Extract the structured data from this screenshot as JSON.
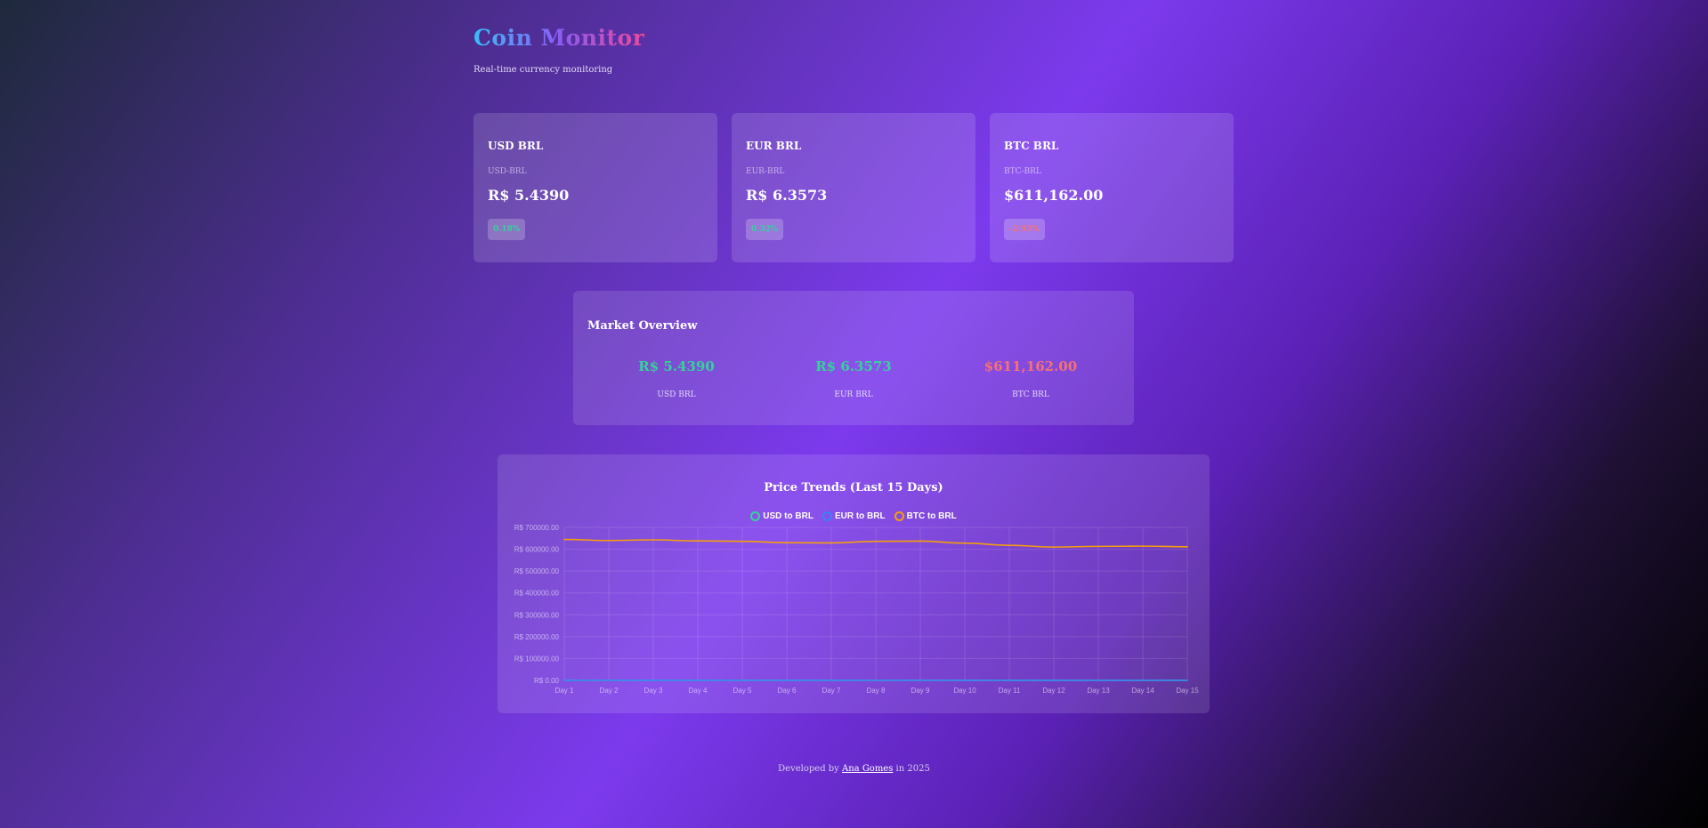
{
  "header": {
    "title": "Coin Monitor",
    "subtitle": "Real-time currency monitoring"
  },
  "cards": [
    {
      "pair": "USD BRL",
      "code": "USD-BRL",
      "price": "R$ 5.4390",
      "change": "0.18%",
      "trend": "up"
    },
    {
      "pair": "EUR BRL",
      "code": "EUR-BRL",
      "price": "R$ 6.3573",
      "change": "0.32%",
      "trend": "up"
    },
    {
      "pair": "BTC BRL",
      "code": "BTC-BRL",
      "price": "$611,162.00",
      "change": "-2.93%",
      "trend": "down"
    }
  ],
  "overview": {
    "title": "Market Overview",
    "items": [
      {
        "value": "R$ 5.4390",
        "label": "USD BRL",
        "trend": "up"
      },
      {
        "value": "R$ 6.3573",
        "label": "EUR BRL",
        "trend": "up"
      },
      {
        "value": "$611,162.00",
        "label": "BTC BRL",
        "trend": "down"
      }
    ]
  },
  "chart_data": {
    "type": "line",
    "title": "Price Trends (Last 15 Days)",
    "categories": [
      "Day 1",
      "Day 2",
      "Day 3",
      "Day 4",
      "Day 5",
      "Day 6",
      "Day 7",
      "Day 8",
      "Day 9",
      "Day 10",
      "Day 11",
      "Day 12",
      "Day 13",
      "Day 14",
      "Day 15"
    ],
    "ylim": [
      0,
      700000
    ],
    "yticks": [
      0,
      100000,
      200000,
      300000,
      400000,
      500000,
      600000,
      700000
    ],
    "ytick_labels": [
      "R$ 0.00",
      "R$ 100000.00",
      "R$ 200000.00",
      "R$ 300000.00",
      "R$ 400000.00",
      "R$ 500000.00",
      "R$ 600000.00",
      "R$ 700000.00"
    ],
    "grid": true,
    "legend_position": "top",
    "series": [
      {
        "name": "USD to BRL",
        "color": "#34d399",
        "values": [
          5.4,
          5.41,
          5.42,
          5.41,
          5.43,
          5.42,
          5.44,
          5.43,
          5.42,
          5.44,
          5.43,
          5.44,
          5.43,
          5.44,
          5.439
        ]
      },
      {
        "name": "EUR to BRL",
        "color": "#3b82f6",
        "values": [
          6.3,
          6.31,
          6.32,
          6.33,
          6.32,
          6.34,
          6.35,
          6.34,
          6.35,
          6.36,
          6.35,
          6.36,
          6.35,
          6.36,
          6.357
        ]
      },
      {
        "name": "BTC to BRL",
        "color": "#f59e0b",
        "values": [
          645000,
          640000,
          643000,
          638000,
          636000,
          630000,
          629000,
          636000,
          637000,
          628000,
          618000,
          610000,
          613000,
          614000,
          611162
        ]
      }
    ]
  },
  "footer": {
    "prefix": "Developed by",
    "author": "Ana Gomes",
    "suffix": "in 2025"
  }
}
